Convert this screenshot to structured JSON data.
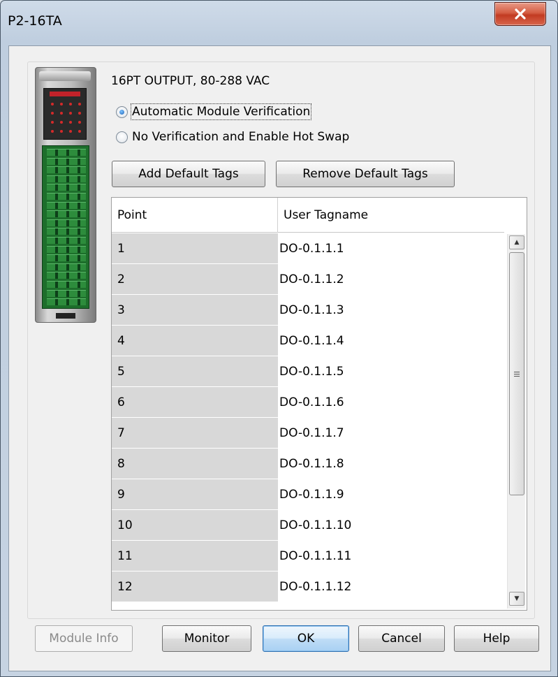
{
  "window": {
    "title": "P2-16TA",
    "close_icon": "close-x-icon"
  },
  "module": {
    "description": "16PT OUTPUT, 80-288 VAC",
    "image": "module-image"
  },
  "verification": {
    "options": [
      {
        "label": "Automatic Module Verification",
        "selected": true
      },
      {
        "label": "No Verification and Enable Hot Swap",
        "selected": false
      }
    ]
  },
  "tag_buttons": {
    "add_label": "Add Default Tags",
    "remove_label": "Remove Default Tags"
  },
  "grid": {
    "columns": [
      "Point",
      "User Tagname"
    ],
    "rows": [
      [
        "1",
        "DO-0.1.1.1"
      ],
      [
        "2",
        "DO-0.1.1.2"
      ],
      [
        "3",
        "DO-0.1.1.3"
      ],
      [
        "4",
        "DO-0.1.1.4"
      ],
      [
        "5",
        "DO-0.1.1.5"
      ],
      [
        "6",
        "DO-0.1.1.6"
      ],
      [
        "7",
        "DO-0.1.1.7"
      ],
      [
        "8",
        "DO-0.1.1.8"
      ],
      [
        "9",
        "DO-0.1.1.9"
      ],
      [
        "10",
        "DO-0.1.1.10"
      ],
      [
        "11",
        "DO-0.1.1.11"
      ],
      [
        "12",
        "DO-0.1.1.12"
      ]
    ]
  },
  "footer": {
    "module_info_label": "Module Info",
    "monitor_label": "Monitor",
    "ok_label": "OK",
    "cancel_label": "Cancel",
    "help_label": "Help"
  }
}
